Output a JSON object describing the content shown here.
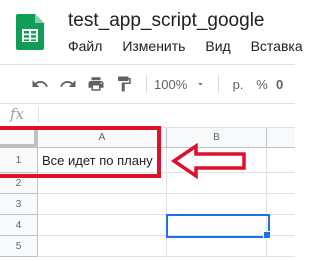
{
  "doc": {
    "title": "test_app_script_google"
  },
  "menu": [
    "Файл",
    "Изменить",
    "Вид",
    "Вставка"
  ],
  "toolbar": {
    "zoom": "100%",
    "currency": "р.",
    "percent": "%",
    "decimal": "0"
  },
  "formula_bar": {
    "fx": "fx",
    "value": ""
  },
  "sheet": {
    "columns": [
      "A",
      "B"
    ],
    "rows": [
      "1",
      "2",
      "3",
      "4",
      "5"
    ],
    "cells": {
      "A1": "Все идет по плану"
    },
    "selected_cell": "B4"
  },
  "annotation": {
    "highlight_color": "#e0102c",
    "arrow_color": "#e0102c"
  },
  "colors": {
    "sheets_green": "#0f9d58",
    "selection_blue": "#1a73e8"
  }
}
